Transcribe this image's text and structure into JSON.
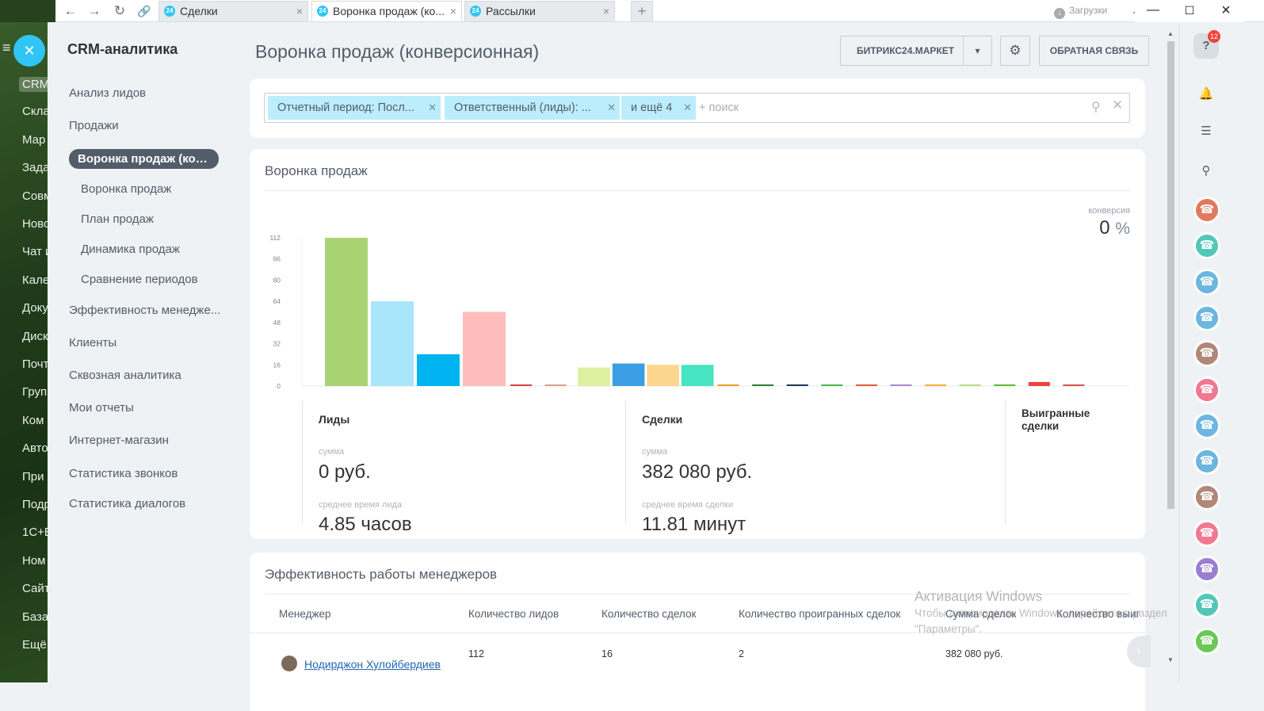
{
  "browser": {
    "tabs": [
      {
        "label": "Сделки",
        "active": false
      },
      {
        "label": "Воронка продаж (ко...",
        "active": true
      },
      {
        "label": "Рассылки",
        "active": false
      }
    ],
    "tab_icon_text": "24",
    "downloads_label": "Загрузки"
  },
  "portal_menu": [
    "CRM",
    "Скла",
    "Мар",
    "Зада",
    "Совм",
    "Ново",
    "Чат и",
    "Кале",
    "Доку",
    "Диск",
    "Почт",
    "Груп",
    "Ком",
    "Авто",
    "При",
    "Подр",
    "1С+Б",
    "Ном",
    "Сайт",
    "База",
    "Ещё"
  ],
  "sidebar": {
    "title": "CRM-аналитика",
    "items": [
      {
        "label": "Анализ лидов",
        "level": 0
      },
      {
        "label": "Продажи",
        "level": 0
      },
      {
        "label": "Воронка продаж (кон...",
        "level": 0,
        "active": true
      },
      {
        "label": "Воронка продаж",
        "level": 1
      },
      {
        "label": "План продаж",
        "level": 1
      },
      {
        "label": "Динамика продаж",
        "level": 1
      },
      {
        "label": "Сравнение периодов",
        "level": 1
      },
      {
        "label": "Эффективность менедже...",
        "level": 0
      },
      {
        "label": "Клиенты",
        "level": 0
      },
      {
        "label": "Сквозная аналитика",
        "level": 0
      },
      {
        "label": "Мои отчеты",
        "level": 0
      },
      {
        "label": "Интернет-магазин",
        "level": 0
      },
      {
        "label": "Статистика звонков",
        "level": 0
      },
      {
        "label": "Статистика диалогов",
        "level": 0
      }
    ]
  },
  "header": {
    "title": "Воронка продаж (конверсионная)",
    "market_button": "БИТРИКС24.МАРКЕТ",
    "feedback_button": "ОБРАТНАЯ СВЯЗЬ"
  },
  "filter": {
    "chips": [
      "Отчетный период: Посл...",
      "Ответственный (лиды): ...",
      "и ещё 4"
    ],
    "search_placeholder": "+ поиск"
  },
  "funnel": {
    "title": "Воронка продаж",
    "conversion_label": "конверсия",
    "conversion_value": "0",
    "conversion_unit": "%",
    "stats": [
      {
        "title": "Лиды",
        "sum_label": "сумма",
        "sum_value": "0 руб.",
        "time_label": "среднее время лида",
        "time_value": "4.85 часов"
      },
      {
        "title": "Сделки",
        "sum_label": "сумма",
        "sum_value": "382 080 руб.",
        "time_label": "среднее время сделки",
        "time_value": "11.81 минут"
      },
      {
        "title": "Выигранные сделки"
      }
    ]
  },
  "chart_data": {
    "type": "bar",
    "title": "",
    "xlabel": "",
    "ylabel": "",
    "ylim": [
      0,
      112
    ],
    "yticks": [
      0,
      16,
      32,
      48,
      64,
      80,
      96,
      112
    ],
    "grid": false,
    "legend": "none",
    "values": [
      112,
      64,
      24,
      56,
      1,
      1,
      14,
      17,
      16,
      16,
      1,
      1,
      1,
      1,
      1,
      1,
      1,
      1,
      1,
      3,
      1
    ],
    "colors": [
      "#a9d373",
      "#a9e5fb",
      "#00b4f1",
      "#ffbcbc",
      "#e04040",
      "#d9a38a",
      "#dcf0a0",
      "#3c9ee5",
      "#fdd68e",
      "#47e4c2",
      "#f0a020",
      "#2e7d32",
      "#1a3a5a",
      "#41c041",
      "#e06030",
      "#b085d5",
      "#f5b040",
      "#b5e080",
      "#55c030",
      "#f04040",
      "#e05050"
    ]
  },
  "managers": {
    "title": "Эффективность работы менеджеров",
    "columns": [
      "Менеджер",
      "Количество лидов",
      "Количество сделок",
      "Количество проигранных сделок",
      "Сумма сделок",
      "Количество выиг"
    ],
    "rows": [
      {
        "name": "Нодирджон Хулойбердиев",
        "leads": "112",
        "deals": "16",
        "lost": "2",
        "sum": "382 080 руб."
      }
    ]
  },
  "windows_activation": {
    "line1": "Активация Windows",
    "line2": "Чтобы активировать Windows, перейдите в раздел",
    "line3": "\"Параметры\"."
  },
  "right_panel": {
    "help_badge": "12",
    "call_colors": [
      "#e07a5f",
      "#52c7b8",
      "#6cb6e0",
      "#6cb6e0",
      "#b08878",
      "#f07890",
      "#6cb6e0",
      "#6cb6e0",
      "#b08878",
      "#f07890",
      "#9a7fd0",
      "#52c7b8",
      "#6bc858"
    ]
  }
}
